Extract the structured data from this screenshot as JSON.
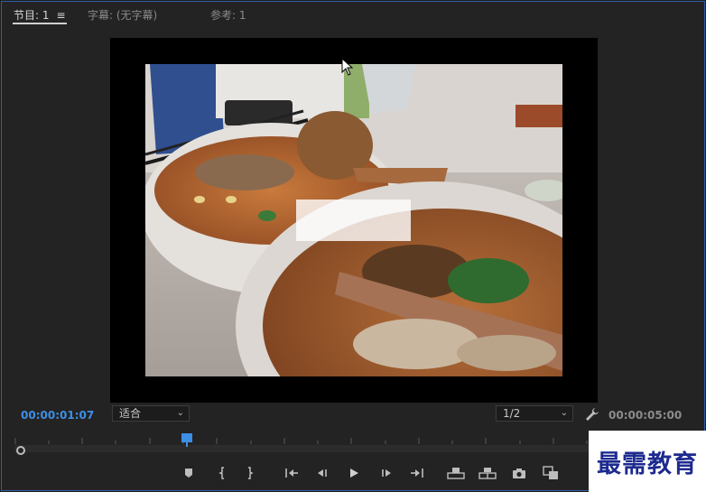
{
  "tabs": [
    {
      "label": "节目: 1",
      "menu": "≡"
    },
    {
      "label": "字幕: (无字幕)"
    },
    {
      "label": "参考: 1"
    }
  ],
  "playback": {
    "current_timecode": "00:00:01:07",
    "fit_label": "适合",
    "resolution_label": "1/2",
    "duration_timecode": "00:00:05:00",
    "playhead_fraction": 0.3
  },
  "controls": [
    {
      "name": "add-marker-icon"
    },
    {
      "name": "mark-in-icon"
    },
    {
      "name": "mark-out-icon"
    },
    {
      "name": "go-to-in-icon"
    },
    {
      "name": "step-back-icon"
    },
    {
      "name": "play-icon"
    },
    {
      "name": "step-forward-icon"
    },
    {
      "name": "go-to-out-icon"
    },
    {
      "name": "lift-icon"
    },
    {
      "name": "extract-icon"
    },
    {
      "name": "export-frame-icon"
    },
    {
      "name": "comparison-view-icon"
    }
  ],
  "colors": {
    "accent": "#3d8fe6",
    "panel": "#232323",
    "border": "#2d5ea8"
  },
  "watermark": {
    "text": "最需教育"
  }
}
